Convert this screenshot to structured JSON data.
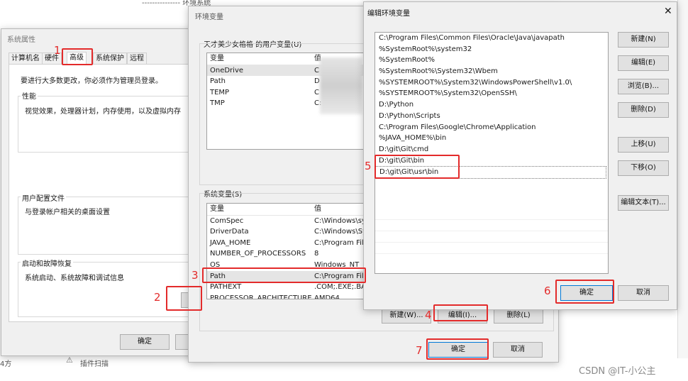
{
  "bg_text": {
    "top_line": "--------------- 环境系统",
    "bottom_left": "4方",
    "bottom_mid": "插件扫描"
  },
  "sysprop": {
    "title": "系统属性",
    "tabs": [
      "计算机名",
      "硬件",
      "高级",
      "系统保护",
      "远程"
    ],
    "admin_note": "要进行大多数更改，你必须作为管理员登录。",
    "perf_label": "性能",
    "perf_desc": "视觉效果，处理器计划，内存使用，以及虚拟内存",
    "profile_label": "用户配置文件",
    "profile_desc": "与登录帐户相关的桌面设置",
    "startup_label": "启动和故障恢复",
    "startup_desc": "系统启动、系统故障和调试信息",
    "ok": "确定"
  },
  "envvars": {
    "title": "环境变量",
    "user_group_label": "天才美少女格格 的用户变量(U)",
    "col_var": "变量",
    "col_val": "值",
    "user_vars": [
      {
        "name": "OneDrive",
        "value": "C"
      },
      {
        "name": "Path",
        "value": "D"
      },
      {
        "name": "TEMP",
        "value": "C"
      },
      {
        "name": "TMP",
        "value": "C:"
      }
    ],
    "sys_group_label": "系统变量(S)",
    "sys_vars": [
      {
        "name": "ComSpec",
        "value": "C:\\Windows\\sys"
      },
      {
        "name": "DriverData",
        "value": "C:\\Windows\\Sys"
      },
      {
        "name": "JAVA_HOME",
        "value": "C:\\Program File"
      },
      {
        "name": "NUMBER_OF_PROCESSORS",
        "value": "8"
      },
      {
        "name": "OS",
        "value": "Windows_NT"
      },
      {
        "name": "Path",
        "value": "C:\\Program Files"
      },
      {
        "name": "PATHEXT",
        "value": ".COM;.EXE;.BAT"
      },
      {
        "name": "PROCESSOR_ARCHITECTURE",
        "value": "AMD64"
      }
    ],
    "new_btn": "新建(W)...",
    "edit_btn": "编辑(I)...",
    "delete_btn": "删除(L)",
    "ok": "确定",
    "cancel": "取消"
  },
  "editenv": {
    "title": "编辑环境变量",
    "paths": [
      "C:\\Program Files\\Common Files\\Oracle\\Java\\javapath",
      "%SystemRoot%\\system32",
      "%SystemRoot%",
      "%SystemRoot%\\System32\\Wbem",
      "%SYSTEMROOT%\\System32\\WindowsPowerShell\\v1.0\\",
      "%SYSTEMROOT%\\System32\\OpenSSH\\",
      "D:\\Python",
      "D:\\Python\\Scripts",
      "C:\\Program Files\\Google\\Chrome\\Application",
      "%JAVA_HOME%\\bin",
      "D:\\git\\Git\\cmd",
      "D:\\git\\Git\\bin",
      "D:\\git\\Git\\usr\\bin"
    ],
    "btn_new": "新建(N)",
    "btn_edit": "编辑(E)",
    "btn_browse": "浏览(B)...",
    "btn_delete": "删除(D)",
    "btn_up": "上移(U)",
    "btn_down": "下移(O)",
    "btn_edit_text": "编辑文本(T)...",
    "ok": "确定",
    "cancel": "取消"
  },
  "step_labels": [
    "1",
    "2",
    "3",
    "4",
    "5",
    "6",
    "7"
  ],
  "watermark": "CSDN @IT-小公主",
  "accent_red": "#e32b2b"
}
